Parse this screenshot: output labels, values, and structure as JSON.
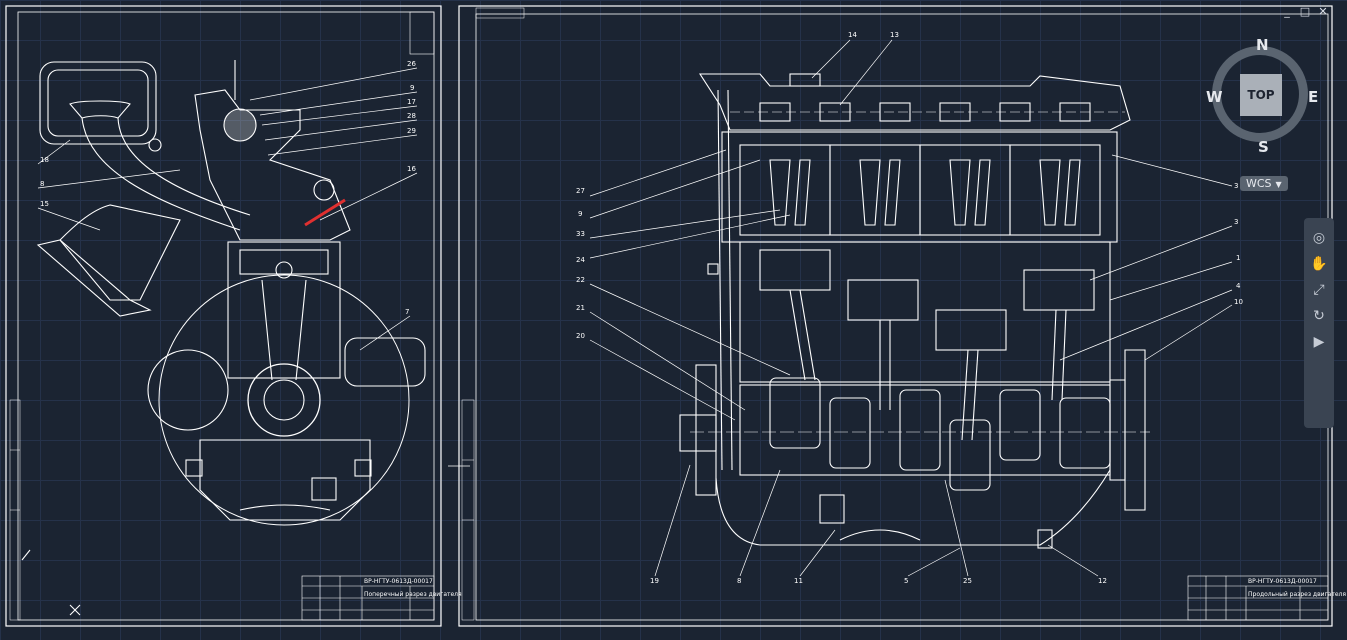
{
  "window": {
    "controls": [
      "_",
      "□",
      "✕"
    ]
  },
  "viewcube": {
    "face": "TOP",
    "north": "N",
    "south": "S",
    "east": "E",
    "west": "W"
  },
  "ucs": {
    "label": "WCS"
  },
  "navigation_bar": {
    "tools": [
      "steering-wheel-icon",
      "pan-icon",
      "zoom-extents-icon",
      "orbit-icon",
      "showmotion-icon"
    ]
  },
  "colors": {
    "background": "#1b2432",
    "grid": "#25324a",
    "lines": "#ffffff",
    "accent_red": "#e03030"
  },
  "sheets": {
    "left": {
      "title_block_code": "ВР-НГТУ-0613Д-00017",
      "title_block_name": "Поперечный разрез двигателя",
      "callouts": [
        "26",
        "9",
        "17",
        "28",
        "29",
        "16",
        "18",
        "8",
        "15",
        "7"
      ]
    },
    "right": {
      "title_block_code": "ВР-НГТУ-0613Д-00017",
      "title_block_name": "Продольный разрез двигателя",
      "callouts": [
        "14",
        "13",
        "27",
        "9",
        "33",
        "24",
        "22",
        "21",
        "20",
        "3",
        "3",
        "1",
        "4",
        "10",
        "19",
        "8",
        "11",
        "5",
        "25",
        "12"
      ]
    }
  }
}
